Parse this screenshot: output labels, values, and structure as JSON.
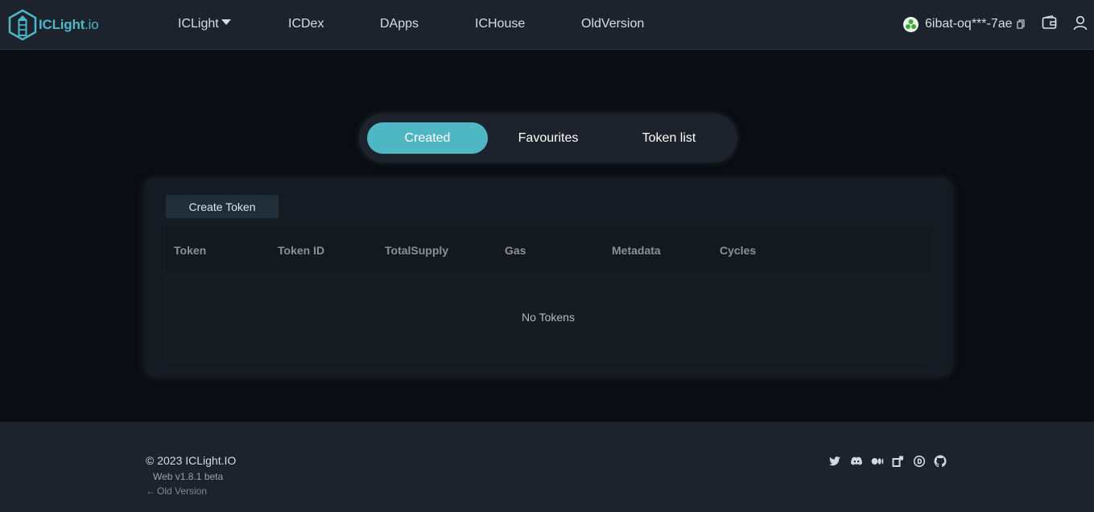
{
  "brand": {
    "name": "ICLight",
    "suffix": ".io",
    "accent": "#4fb6c8"
  },
  "nav": {
    "items": [
      {
        "label": "ICLight",
        "has_dropdown": true
      },
      {
        "label": "ICDex"
      },
      {
        "label": "DApps"
      },
      {
        "label": "ICHouse"
      },
      {
        "label": "OldVersion"
      }
    ]
  },
  "account": {
    "principal": "6ibat-oq***-7ae",
    "icons": [
      "avatar-icon",
      "copy-icon",
      "wallet-icon",
      "user-icon"
    ]
  },
  "tabs": [
    {
      "label": "Created",
      "active": true
    },
    {
      "label": "Favourites",
      "active": false
    },
    {
      "label": "Token list",
      "active": false
    }
  ],
  "panel": {
    "create_label": "Create Token",
    "columns": [
      "Token",
      "Token ID",
      "TotalSupply",
      "Gas",
      "Metadata",
      "Cycles"
    ],
    "empty_text": "No Tokens"
  },
  "footer": {
    "copyright": "© 2023 ICLight.IO",
    "version": "Web v1.8.1 beta",
    "old_version": "Old Version",
    "social_icons": [
      "twitter-icon",
      "discord-icon",
      "medium-icon",
      "openchat-icon",
      "dscvr-icon",
      "github-icon"
    ]
  },
  "colors": {
    "tab_active": "#4fb6c3",
    "background": "#0a0d12",
    "header": "#1c232c"
  }
}
